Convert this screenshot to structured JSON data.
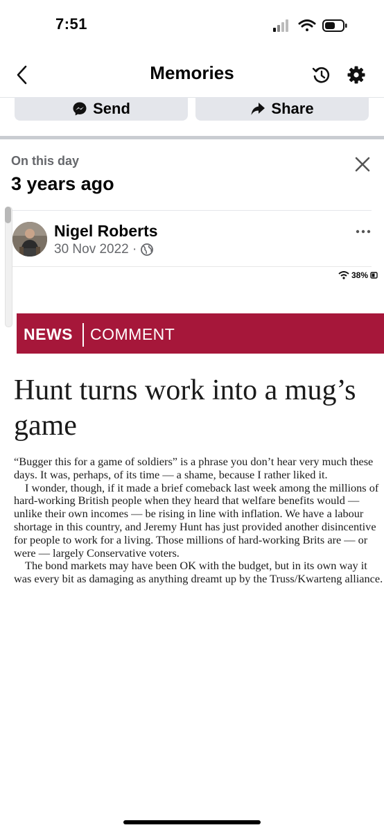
{
  "status_bar": {
    "time": "7:51"
  },
  "nav": {
    "title": "Memories"
  },
  "actions": {
    "send_label": "Send",
    "share_label": "Share"
  },
  "memory": {
    "section_label": "On this day",
    "years_label": "3 years ago"
  },
  "post": {
    "author": "Nigel Roberts",
    "date": "30 Nov 2022 ·",
    "audience_icon": "globe-icon"
  },
  "screenshot": {
    "battery": "38%",
    "section": "NEWS",
    "subsection": "COMMENT",
    "headline": "Hunt turns work into a mug’s game",
    "paragraphs": [
      "“Bugger this for a game of soldiers” is a phrase you don’t hear very much these days. It was, perhaps, of its time — a shame, because I rather liked it.",
      "I wonder, though, if it made a brief comeback last week among the millions of hard-working British people when they heard that welfare benefits would — unlike their own incomes — be rising in line with inflation. We have a labour shortage in this country, and Jeremy Hunt has just provided another disincentive for people to work for a living. Those millions of hard-working Brits are — or were — largely Conservative voters.",
      "The bond markets may have been OK with the budget, but in its own way it was every bit as damaging as anything dreamt up by the Truss/Kwarteng alliance."
    ]
  },
  "colors": {
    "banner": "#a6173a",
    "secondary_text": "#65676b",
    "button_bg": "#e4e6eb"
  }
}
